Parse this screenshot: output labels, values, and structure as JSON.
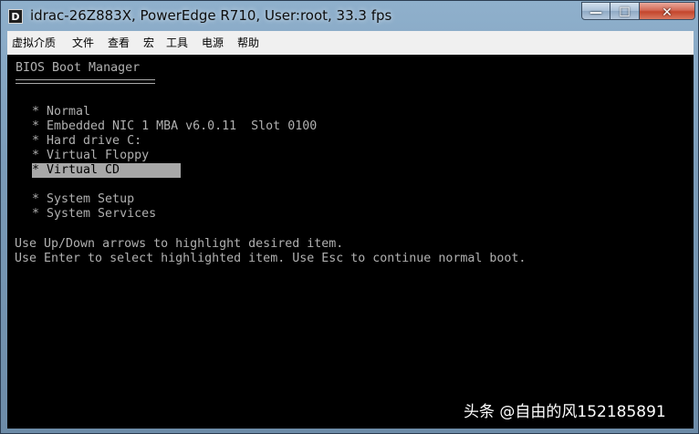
{
  "window": {
    "title": "idrac-26Z883X, PowerEdge R710, User:root, 33.3 fps",
    "app_icon_letter": "D",
    "minimize_glyph": "—",
    "maximize_glyph": "☐",
    "close_glyph": "✕"
  },
  "menu": [
    "虚拟介质",
    "文件",
    "查看",
    "宏",
    "工具",
    "电源",
    "帮助"
  ],
  "console": {
    "header": "BIOS Boot Manager",
    "boot_items": [
      "* Normal",
      "* Embedded NIC 1 MBA v6.0.11  Slot 0100",
      "* Hard drive C:",
      "* Virtual Floppy",
      "* Virtual CD          "
    ],
    "setup_items": [
      "* System Setup",
      "* System Services"
    ],
    "help_lines": [
      "Use Up/Down arrows to highlight desired item.",
      "Use Enter to select highlighted item. Use Esc to continue normal boot."
    ],
    "selected_index": 4
  },
  "watermark": "头条 @自由的风152185891",
  "colors": {
    "console_bg": "#000000",
    "console_text": "#b0b0b0",
    "highlight_bg": "#a8a8a8",
    "close_button": "#c4452c"
  }
}
